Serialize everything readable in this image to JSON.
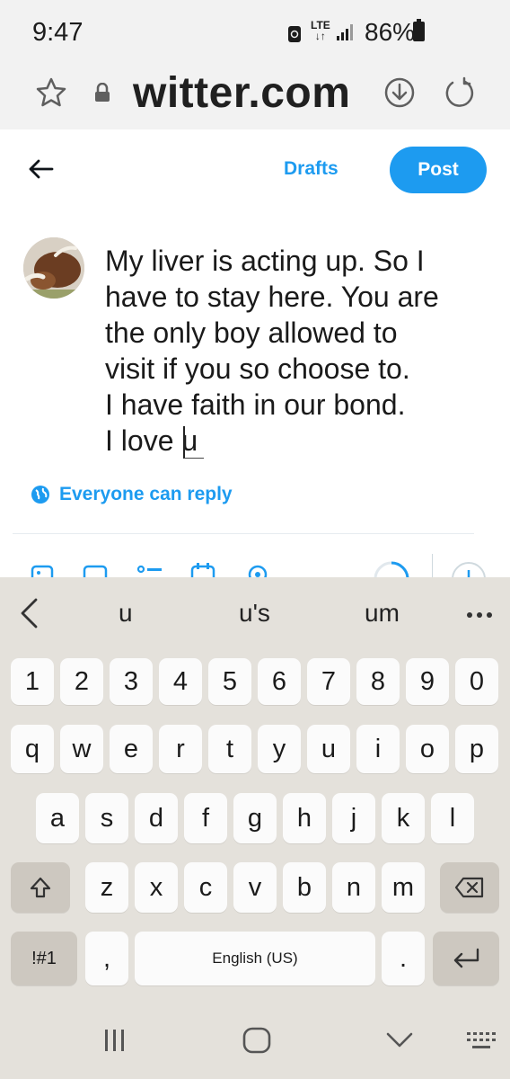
{
  "status": {
    "time": "9:47",
    "network": "LTE",
    "battery": "86%"
  },
  "browser": {
    "url": "witter.com"
  },
  "compose": {
    "drafts_label": "Drafts",
    "post_label": "Post",
    "text": "My liver is acting up. So I\nhave to stay here. You are\nthe only boy allowed to\nvisit if you so choose to.\nI have faith in our bond.\nI love u",
    "reply_setting": "Everyone can reply"
  },
  "keyboard": {
    "suggestions": [
      "u",
      "u's",
      "um"
    ],
    "number_row": [
      "1",
      "2",
      "3",
      "4",
      "5",
      "6",
      "7",
      "8",
      "9",
      "0"
    ],
    "row1": [
      "q",
      "w",
      "e",
      "r",
      "t",
      "y",
      "u",
      "i",
      "o",
      "p"
    ],
    "row2": [
      "a",
      "s",
      "d",
      "f",
      "g",
      "h",
      "j",
      "k",
      "l"
    ],
    "row3": [
      "z",
      "x",
      "c",
      "v",
      "b",
      "n",
      "m"
    ],
    "symbols_label": "!#1",
    "comma_label": ",",
    "space_label": "English (US)",
    "period_label": "."
  },
  "colors": {
    "accent": "#1d9bf0",
    "keyboard_bg": "#e4e1db"
  }
}
